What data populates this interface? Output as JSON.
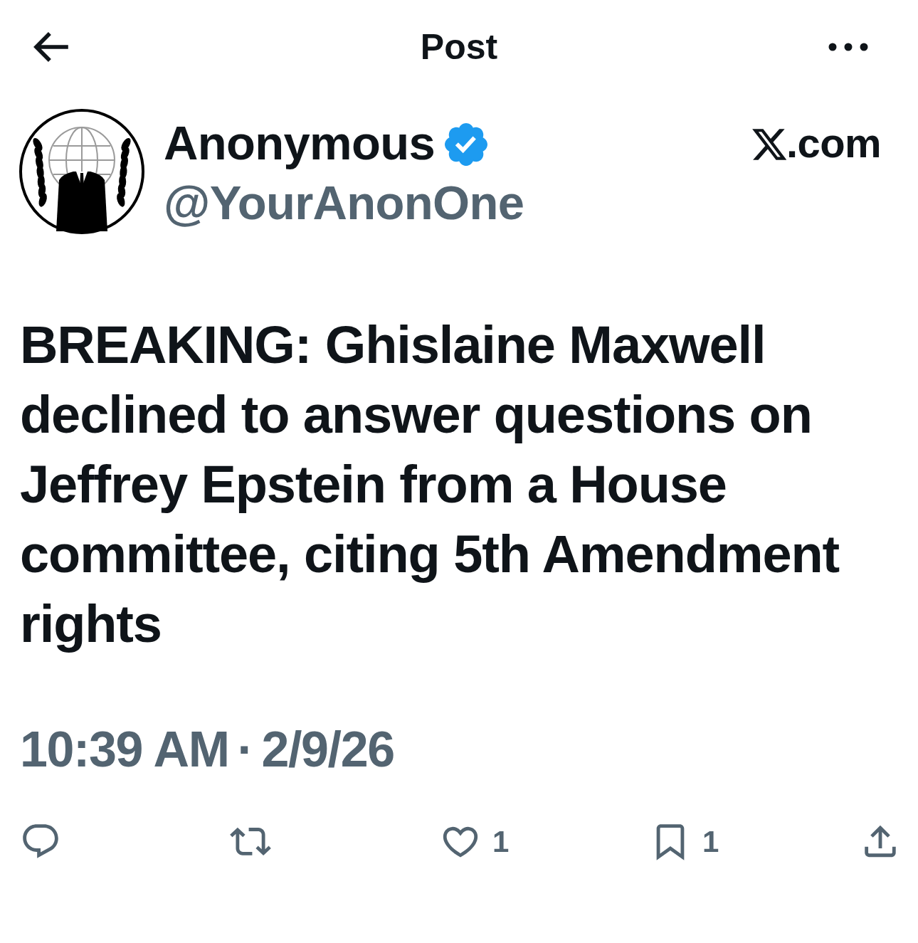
{
  "header": {
    "title": "Post"
  },
  "post": {
    "author": {
      "name": "Anonymous",
      "verified": true,
      "handle": "@YourAnonOne"
    },
    "source": ".com",
    "text": "BREAKING: Ghislaine Maxwell declined to answer questions on Jeffrey Epstein from a House committee, citing 5th Amendment rights",
    "time": "10:39 AM",
    "separator": "·",
    "date": "2/9/26"
  },
  "actions": [
    {
      "kind": "reply"
    },
    {
      "kind": "repost"
    },
    {
      "kind": "like",
      "count": "1"
    },
    {
      "kind": "bookmark",
      "count": "1"
    },
    {
      "kind": "share"
    }
  ]
}
